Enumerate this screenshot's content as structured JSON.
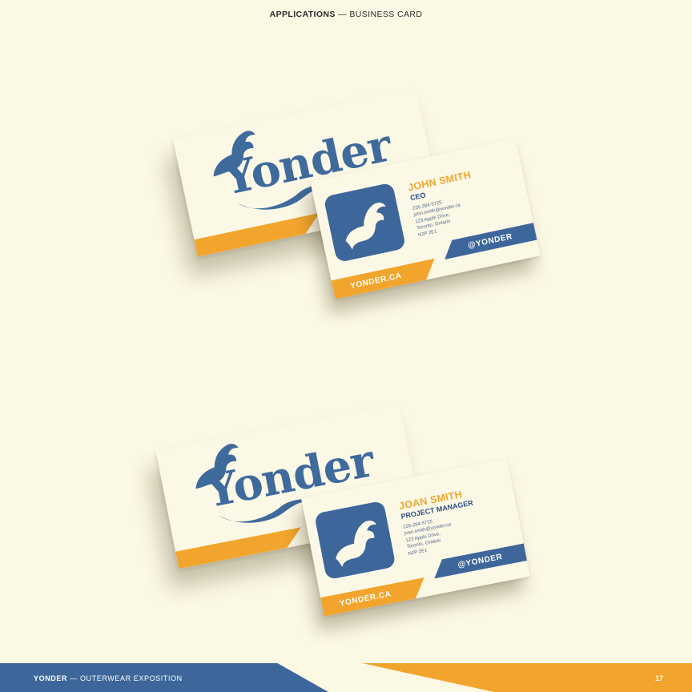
{
  "header": {
    "section": "APPLICATIONS",
    "separator": "—",
    "subtitle": "BUSINESS CARD"
  },
  "brand": {
    "logo_text": "Yonder",
    "primary_color": "#3d679b",
    "accent_color": "#f2a52c",
    "background_color": "#fbf8e4",
    "logo_icon": "goat-icon"
  },
  "cards": [
    {
      "name": "JOHN SMITH",
      "title": "CEO",
      "phone": "226-284-5725",
      "email": "john.smith@yonder.ca",
      "address_line1": "123 Apple Drive,",
      "address_line2": "Toronto, Ontario",
      "postal": "N2P 2E1",
      "website": "YONDER.CA",
      "handle": "@YONDER"
    },
    {
      "name": "JOAN SMITH",
      "title": "PROJECT MANAGER",
      "phone": "226-284-5725",
      "email": "joan.smith@yonder.ca",
      "address_line1": "123 Apple Drive,",
      "address_line2": "Toronto, Ontario",
      "postal": "N2P 2E1",
      "website": "YONDER.CA",
      "handle": "@YONDER"
    }
  ],
  "footer": {
    "brand": "YONDER",
    "separator": "—",
    "label": "OUTERWEAR EXPOSITION",
    "page_number": "17"
  }
}
